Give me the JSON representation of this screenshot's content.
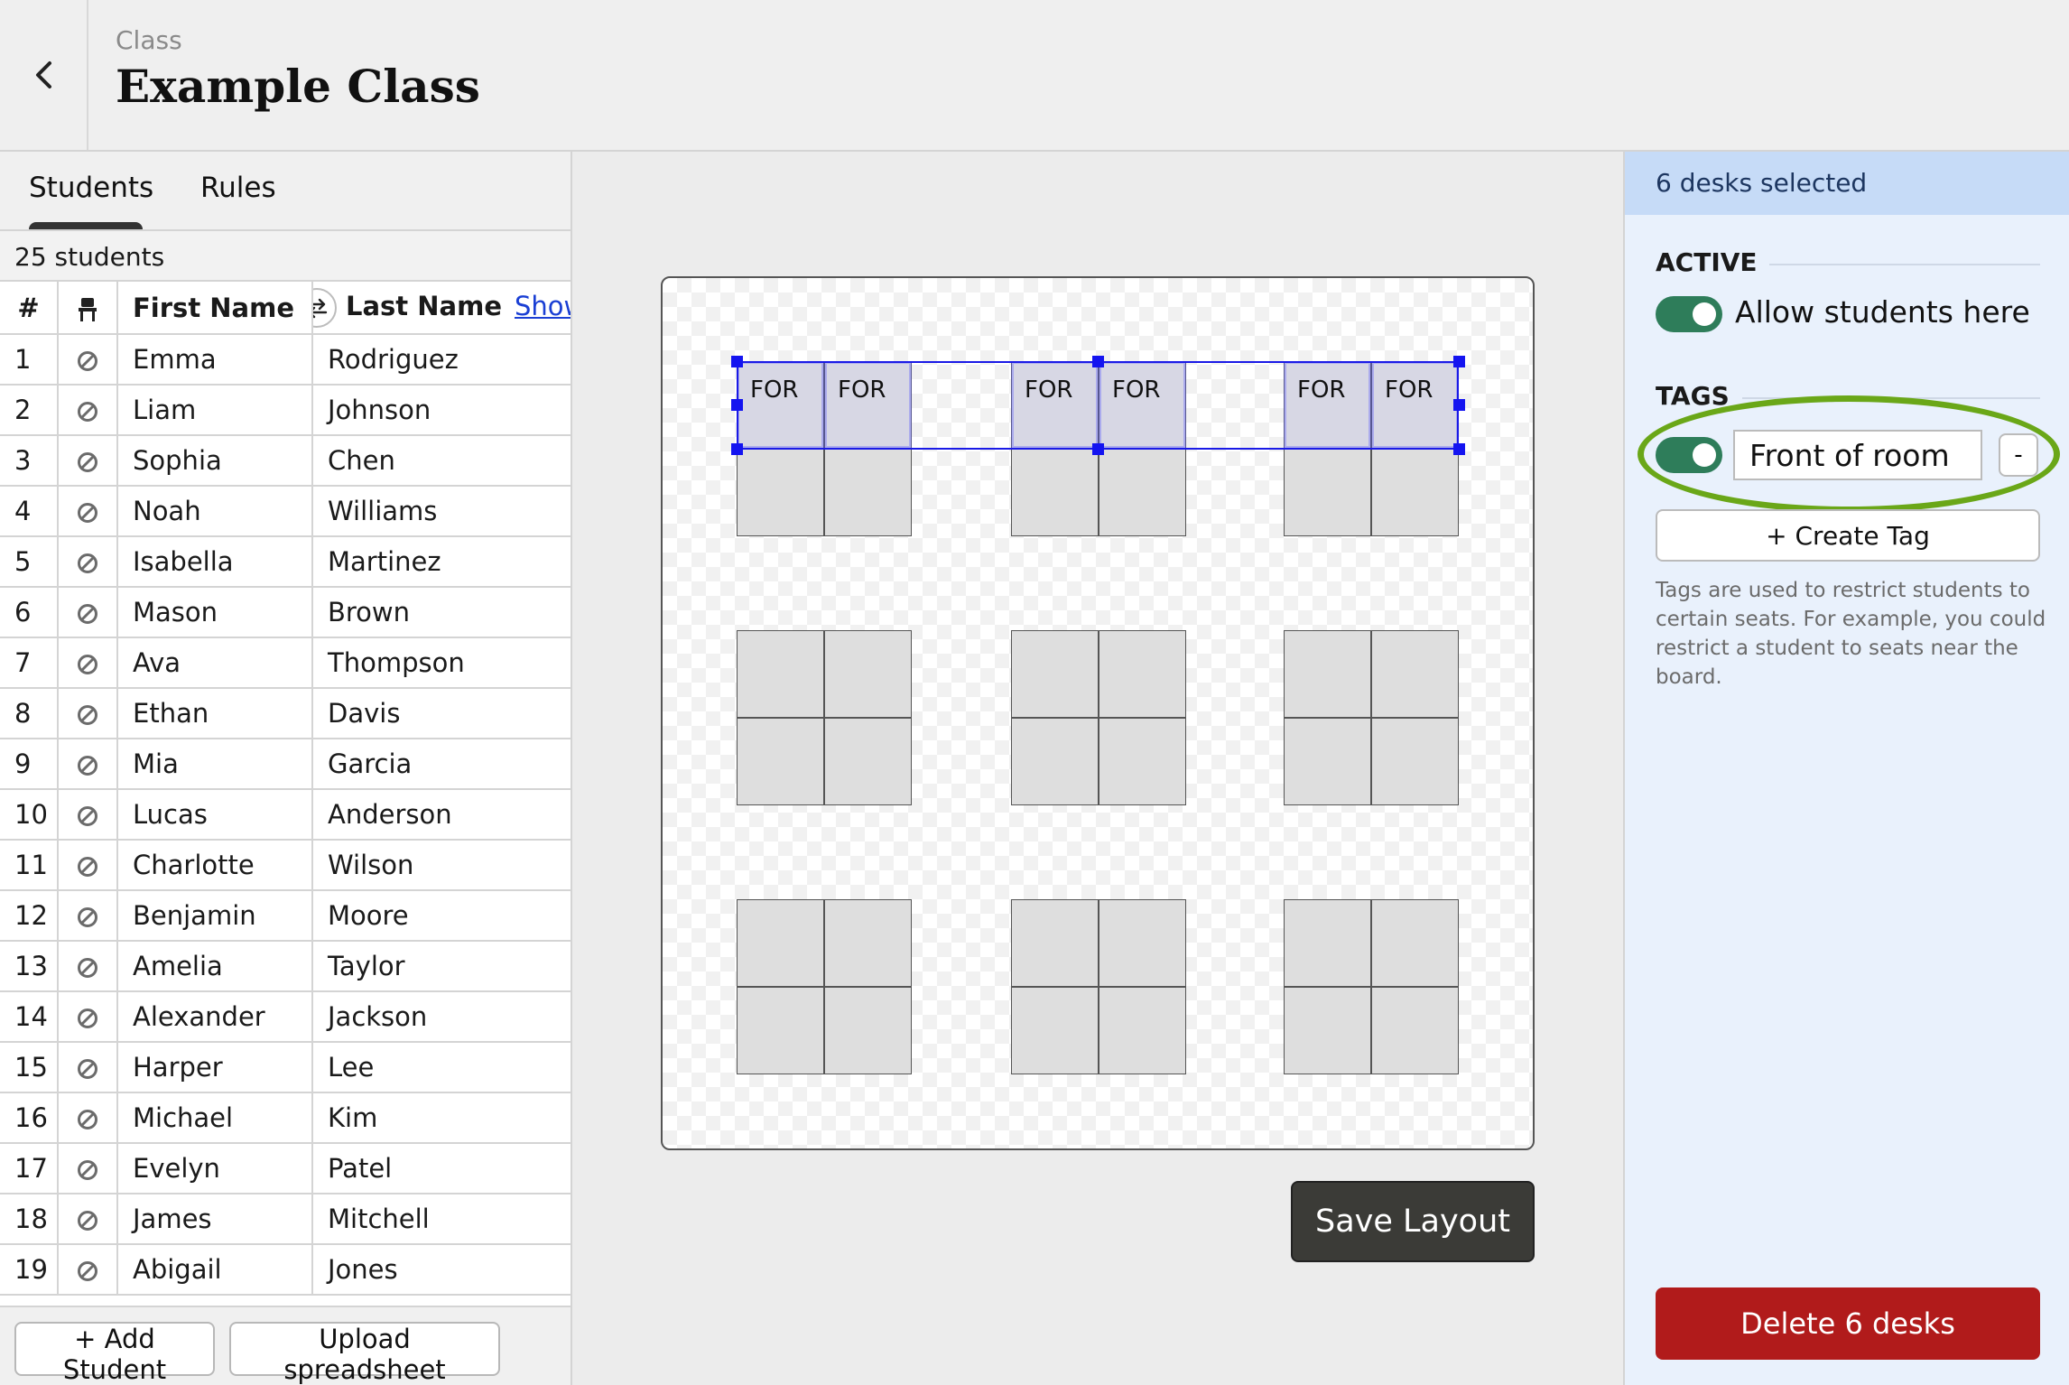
{
  "header": {
    "breadcrumb": "Class",
    "title": "Example Class"
  },
  "left_panel": {
    "tabs": [
      {
        "label": "Students",
        "active": true
      },
      {
        "label": "Rules",
        "active": false
      }
    ],
    "student_count": "25 students",
    "table": {
      "headers": {
        "num": "#",
        "first": "First Name",
        "last": "Last Name",
        "show_link": "Show"
      },
      "rows": [
        {
          "num": "1",
          "first": "Emma",
          "last": "Rodriguez"
        },
        {
          "num": "2",
          "first": "Liam",
          "last": "Johnson"
        },
        {
          "num": "3",
          "first": "Sophia",
          "last": "Chen"
        },
        {
          "num": "4",
          "first": "Noah",
          "last": "Williams"
        },
        {
          "num": "5",
          "first": "Isabella",
          "last": "Martinez"
        },
        {
          "num": "6",
          "first": "Mason",
          "last": "Brown"
        },
        {
          "num": "7",
          "first": "Ava",
          "last": "Thompson"
        },
        {
          "num": "8",
          "first": "Ethan",
          "last": "Davis"
        },
        {
          "num": "9",
          "first": "Mia",
          "last": "Garcia"
        },
        {
          "num": "10",
          "first": "Lucas",
          "last": "Anderson"
        },
        {
          "num": "11",
          "first": "Charlotte",
          "last": "Wilson"
        },
        {
          "num": "12",
          "first": "Benjamin",
          "last": "Moore"
        },
        {
          "num": "13",
          "first": "Amelia",
          "last": "Taylor"
        },
        {
          "num": "14",
          "first": "Alexander",
          "last": "Jackson"
        },
        {
          "num": "15",
          "first": "Harper",
          "last": "Lee"
        },
        {
          "num": "16",
          "first": "Michael",
          "last": "Kim"
        },
        {
          "num": "17",
          "first": "Evelyn",
          "last": "Patel"
        },
        {
          "num": "18",
          "first": "James",
          "last": "Mitchell"
        },
        {
          "num": "19",
          "first": "Abigail",
          "last": "Jones"
        }
      ]
    },
    "buttons": {
      "add_student": "+ Add Student",
      "upload": "Upload spreadsheet"
    }
  },
  "layout": {
    "desk_label": "FOR",
    "save_label": "Save Layout"
  },
  "right_panel": {
    "selection_text": "6 desks selected",
    "active_title": "ACTIVE",
    "allow_label": "Allow students here",
    "allow_enabled": true,
    "tags_title": "TAGS",
    "tag_value": "Front of room",
    "tag_enabled": true,
    "minus_label": "-",
    "create_tag_label": "+ Create Tag",
    "help_text": "Tags are used to restrict students to certain seats. For example, you could restrict a student to seats near the board.",
    "delete_label": "Delete 6 desks"
  },
  "colors": {
    "toggle_on": "#2e7d5a",
    "selection": "#1414f0",
    "highlight_ring": "#6aa718",
    "delete": "#b11b1b",
    "save": "#3b3b37"
  }
}
